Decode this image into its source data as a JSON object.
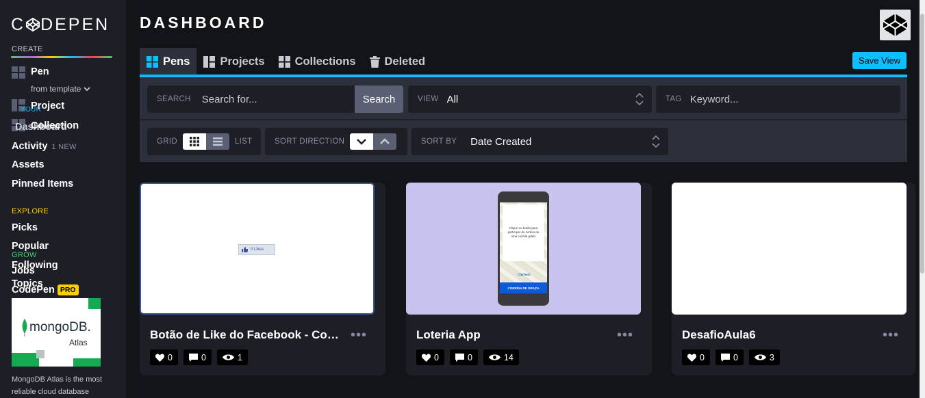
{
  "sidebar": {
    "logo_text": "C DEPEN",
    "create_label": "CREATE",
    "pen_label": "Pen",
    "from_template": "from template",
    "project_label": "Project",
    "collection_label": "Collection",
    "your_work_label": "YOUR",
    "dashboard_label": "Dashboard",
    "activity_label": "Activity",
    "activity_badge": "1 NEW",
    "assets_label": "Assets",
    "pinned_label": "Pinned Items",
    "explore_label": "EXPLORE",
    "picks_label": "Picks",
    "popular_label": "Popular",
    "following_label": "Following",
    "topics_label": "Topics",
    "grow_label": "GROW",
    "jobs_label": "Jobs",
    "codepen_label": "CodePen",
    "pro_badge": "PRO",
    "ad_brand": "mongoDB.",
    "ad_sub": "Atlas",
    "ad_text_1": "MongoDB Atlas is the most",
    "ad_text_2": "reliable cloud database"
  },
  "header": {
    "title": "DASHBOARD",
    "save_view": "Save View"
  },
  "tabs": [
    {
      "label": "Pens",
      "active": true
    },
    {
      "label": "Projects",
      "active": false
    },
    {
      "label": "Collections",
      "active": false
    },
    {
      "label": "Deleted",
      "active": false
    }
  ],
  "filters": {
    "search_label": "SEARCH",
    "search_placeholder": "Search for...",
    "search_button": "Search",
    "view_label": "VIEW",
    "view_value": "All",
    "tag_label": "TAG",
    "tag_placeholder": "Keyword...",
    "grid_label": "GRID",
    "list_label": "LIST",
    "sort_direction_label": "SORT DIRECTION",
    "sort_by_label": "SORT BY",
    "sort_by_value": "Date Created"
  },
  "cards": [
    {
      "title": "Botão de Like do Facebook - Cont...",
      "likes": "0",
      "comments": "0",
      "views": "1",
      "preview_text": "0 Likes"
    },
    {
      "title": "Loteria App",
      "likes": "0",
      "comments": "0",
      "views": "14",
      "preview_text": "Clique no botão para participar do sorteio de uma corrida grátis",
      "preview_button": "CORRIDA DE GRAÇA",
      "preview_logo": "CityTech"
    },
    {
      "title": "DesafioAula6",
      "likes": "0",
      "comments": "0",
      "views": "3"
    }
  ],
  "colors": {
    "accent": "#0ebeff",
    "sidebar_bg": "#1e1f26",
    "page_bg": "#131417",
    "explore": "#fcd000",
    "grow": "#47cf73",
    "pro": "#fcd000"
  }
}
